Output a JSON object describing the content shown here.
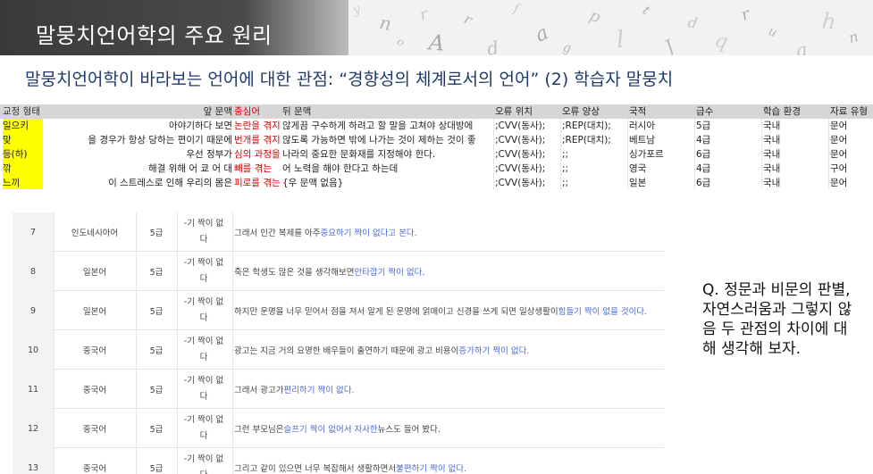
{
  "header": {
    "title": "말뭉치언어학의 주요 원리",
    "decor_letters": [
      "y",
      "n",
      "o",
      "r",
      "A",
      "r",
      "d",
      "f",
      "a",
      "g",
      "p",
      "l",
      "t",
      "J",
      "d",
      "q",
      "r",
      "u",
      "g",
      "h",
      "n"
    ]
  },
  "subtitle": "말뭉치언어학이 바라보는 언어에 대한 관점:  “경향성의 체계로서의 언어” (2) 학습자 말뭉치",
  "concordance": {
    "headers": {
      "form": "교정 형태",
      "front_context": "앞 문맥",
      "center": "중심어",
      "back_context": "뒤 문맥",
      "error_pos": "오류 위치",
      "error_type": "오류 양상",
      "nationality": "국적",
      "level": "급수",
      "environment": "학습 환경",
      "material": "자료 유형"
    },
    "rows": [
      {
        "form": "일으키",
        "front": "아야기하다 보면",
        "center": "논란을 겪지",
        "back": "않게끔 구수하게 하려고 할 말을 고쳐야 상대방에",
        "error_pos": ";CVV(동사);",
        "error_type": ";REP(대치);",
        "nationality": "러시아",
        "level": "5급",
        "environment": "국내",
        "material": "문어"
      },
      {
        "form": "맞",
        "front": "을 경우가 항상 당하는 편이기 때문에",
        "center": "번개를 겪지",
        "back": "않도록 가능하면 밖에 나가는 것이 제하는 것이 좋",
        "error_pos": ";CVV(동사);",
        "error_type": ";REP(대치);",
        "nationality": "베트남",
        "level": "4급",
        "environment": "국내",
        "material": "문어"
      },
      {
        "form": "등(하)",
        "front": "우선 정부가",
        "center": "심의 과정을 겪고",
        "back": "나라의 중요한 문화재를 지정해야 한다.",
        "error_pos": ";CVV(동사);",
        "error_type": ";;",
        "nationality": "싱가포르",
        "level": "6급",
        "environment": "국내",
        "material": "문어"
      },
      {
        "form": "깎",
        "front": "해결 위해 어 쿄 어 대",
        "center": "빼를 겪는",
        "back": "어 노력을 해야 한다고 하는데",
        "error_pos": ";CVV(동사);",
        "error_type": ";;",
        "nationality": "영국",
        "level": "4급",
        "environment": "국내",
        "material": "구어"
      },
      {
        "form": "느끼",
        "front": "이 스트레스로 인해 우리의 몸은",
        "center": "피로를 겪는다.",
        "back": "{우 문맥 없음}",
        "error_pos": ";CVV(동사);",
        "error_type": ";;",
        "nationality": "일본",
        "level": "6급",
        "environment": "국내",
        "material": "문어"
      }
    ]
  },
  "learner_table": {
    "rows": [
      {
        "num": "7",
        "nationality": "인도네시아어",
        "level": "5급",
        "marker": "-기 짝이 없\n다",
        "pre": "그래서 인간 복제를 아주 ",
        "hl": "중요하기 짝이 없다고 본다.",
        "post": ""
      },
      {
        "num": "8",
        "nationality": "일본어",
        "level": "5급",
        "marker": "-기 짝이 없\n다",
        "pre": "죽은 학생도 많은 것을 생각해보면 ",
        "hl": "안타깝기 짝이 없다.",
        "post": ""
      },
      {
        "num": "9",
        "nationality": "일본어",
        "level": "5급",
        "marker": "-기 짝이 없\n다",
        "pre": "하지만 운명을 너무 믿어서 점을 져서 알게 된 운명에 얽매이고 신경을 쓰게 되면 일상생활이 ",
        "hl": "힘들기 짝이 없을 것이다.",
        "post": ""
      },
      {
        "num": "10",
        "nationality": "중국어",
        "level": "5급",
        "marker": "-기 짝이 없\n다",
        "pre": "광고는 지금 거의 요명한 배우들이 출연하기 때문에 광고 비용이 ",
        "hl": "증가하기 짝이 없다.",
        "post": ""
      },
      {
        "num": "11",
        "nationality": "중국어",
        "level": "5급",
        "marker": "-기 짝이 없\n다",
        "pre": "그래서 광고가 ",
        "hl": "편리하기 짝이 없다.",
        "post": ""
      },
      {
        "num": "12",
        "nationality": "중국어",
        "level": "5급",
        "marker": "-기 짝이 없\n다",
        "pre": "그런 부모님은 ",
        "hl": "슬프기 짝이 없어서 자사한",
        "post": " 뉴스도 들어 봤다."
      },
      {
        "num": "13",
        "nationality": "중국어",
        "level": "5급",
        "marker": "-기 짝이 없\n다",
        "pre": "그리고 같이 있으면 너무 복잡해서 생활하면서 ",
        "hl": "불편하기 짝이 없다.",
        "post": ""
      }
    ]
  },
  "question": "Q. 정문과 비문의 판별, 자연스러움과 그렇지 않음 두 관점의 차이에 대해 생각해 보자."
}
